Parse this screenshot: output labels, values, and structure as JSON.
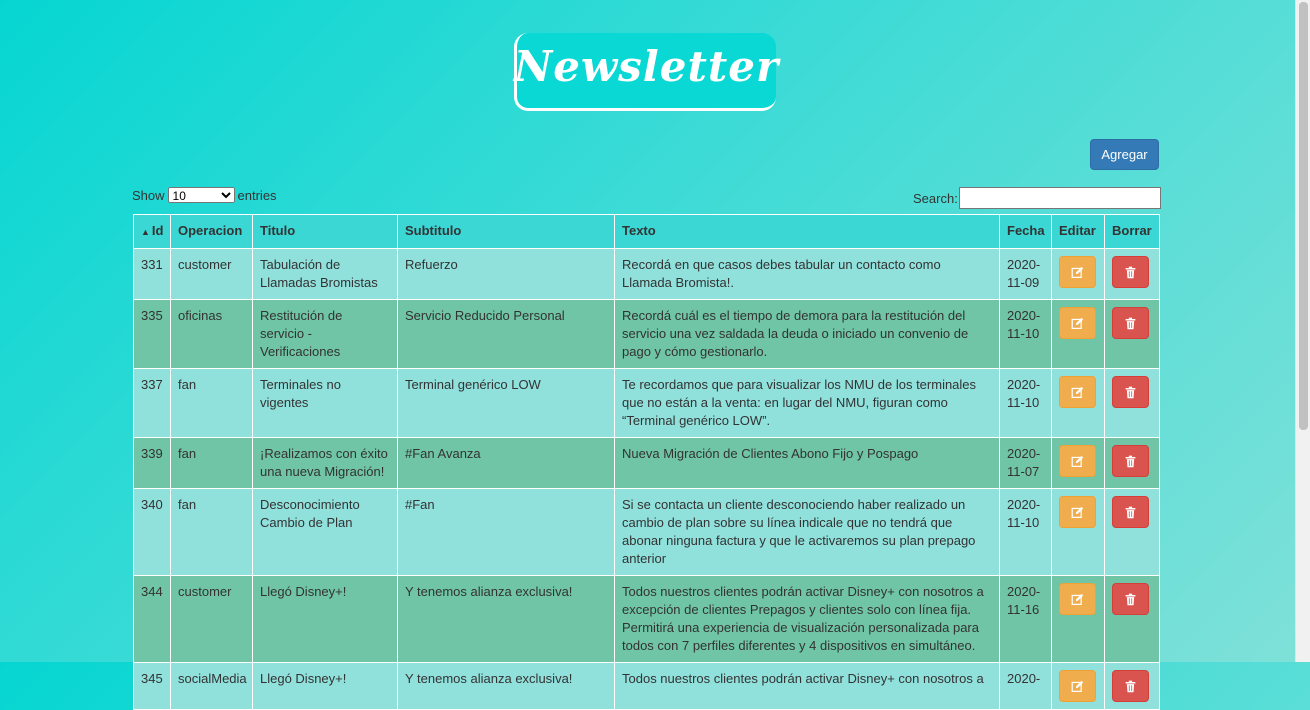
{
  "logo_text": "Newsletter",
  "add_button": "Agregar",
  "length": {
    "show": "Show",
    "selected": "10",
    "entries": "entries"
  },
  "search": {
    "label": "Search:",
    "value": ""
  },
  "columns": [
    "Id",
    "Operacion",
    "Titulo",
    "Subtitulo",
    "Texto",
    "Fecha",
    "Editar",
    "Borrar"
  ],
  "sort_indicator": "▲",
  "rows": [
    {
      "id": "331",
      "operacion": "customer",
      "titulo": "Tabulación de Llamadas Bromistas",
      "subtitulo": "Refuerzo",
      "texto": "Recordá en que casos debes tabular un contacto como Llamada Bromista!.",
      "fecha": "2020-11-09"
    },
    {
      "id": "335",
      "operacion": "oficinas",
      "titulo": "Restitución de servicio - Verificaciones",
      "subtitulo": "Servicio Reducido Personal",
      "texto": "Recordá cuál es el tiempo de demora para la restitución del servicio una vez saldada la deuda o iniciado un convenio de pago y cómo gestionarlo.",
      "fecha": "2020-11-10"
    },
    {
      "id": "337",
      "operacion": "fan",
      "titulo": "Terminales no vigentes",
      "subtitulo": "Terminal genérico LOW",
      "texto": "Te recordamos que para visualizar los NMU de los terminales que no están a la venta: en lugar del NMU, figuran como “Terminal genérico LOW”.",
      "fecha": "2020-11-10"
    },
    {
      "id": "339",
      "operacion": "fan",
      "titulo": "¡Realizamos con éxito una nueva Migración!",
      "subtitulo": "#Fan Avanza",
      "texto": "Nueva Migración de Clientes Abono Fijo y Pospago",
      "fecha": "2020-11-07"
    },
    {
      "id": "340",
      "operacion": "fan",
      "titulo": "Desconocimiento Cambio de Plan",
      "subtitulo": "#Fan",
      "texto": "Si se contacta un cliente desconociendo haber realizado un cambio de plan sobre su línea indicale que no tendrá que abonar ninguna factura y que le activaremos su plan prepago anterior",
      "fecha": "2020-11-10"
    },
    {
      "id": "344",
      "operacion": "customer",
      "titulo": "Llegó Disney+!",
      "subtitulo": "Y tenemos alianza exclusiva!",
      "texto": "Todos nuestros clientes podrán activar Disney+ con nosotros a excepción de clientes Prepagos y clientes solo con línea fija. Permitirá una experiencia de visualización personalizada para todos con 7 perfiles diferentes y 4 dispositivos en simultáneo.",
      "fecha": "2020-11-16"
    },
    {
      "id": "345",
      "operacion": "socialMedia",
      "titulo": "Llegó Disney+!",
      "subtitulo": "Y tenemos alianza exclusiva!",
      "texto": "Todos nuestros clientes podrán activar Disney+ con nosotros a",
      "fecha": "2020-"
    }
  ],
  "colors": {
    "accent": "#337ab7",
    "edit": "#f0ad4e",
    "delete": "#d9534f",
    "row_odd": "#90e0dc",
    "row_even": "#6fc5a6"
  }
}
